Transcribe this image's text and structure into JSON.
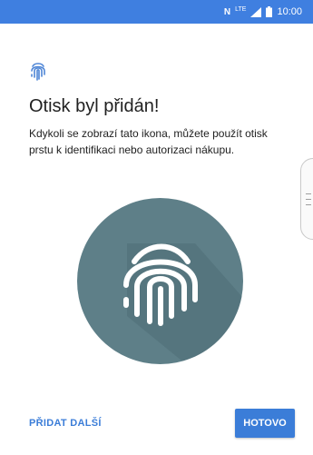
{
  "status_bar": {
    "nfc": "N",
    "network": "LTE",
    "time": "10:00"
  },
  "screen": {
    "title": "Otisk byl přidán!",
    "description": "Kdykoli se zobrazí tato ikona, můžete použít otisk prstu k identifikaci nebo autorizaci nákupu."
  },
  "buttons": {
    "add_another": "PŘIDAT DALŠÍ",
    "done": "HOTOVO"
  },
  "colors": {
    "status_bar": "#3f7fe0",
    "accent": "#3b7dd8",
    "circle": "#5e7f88"
  },
  "icons": {
    "small": "fingerprint-icon",
    "large": "fingerprint-large-icon"
  }
}
